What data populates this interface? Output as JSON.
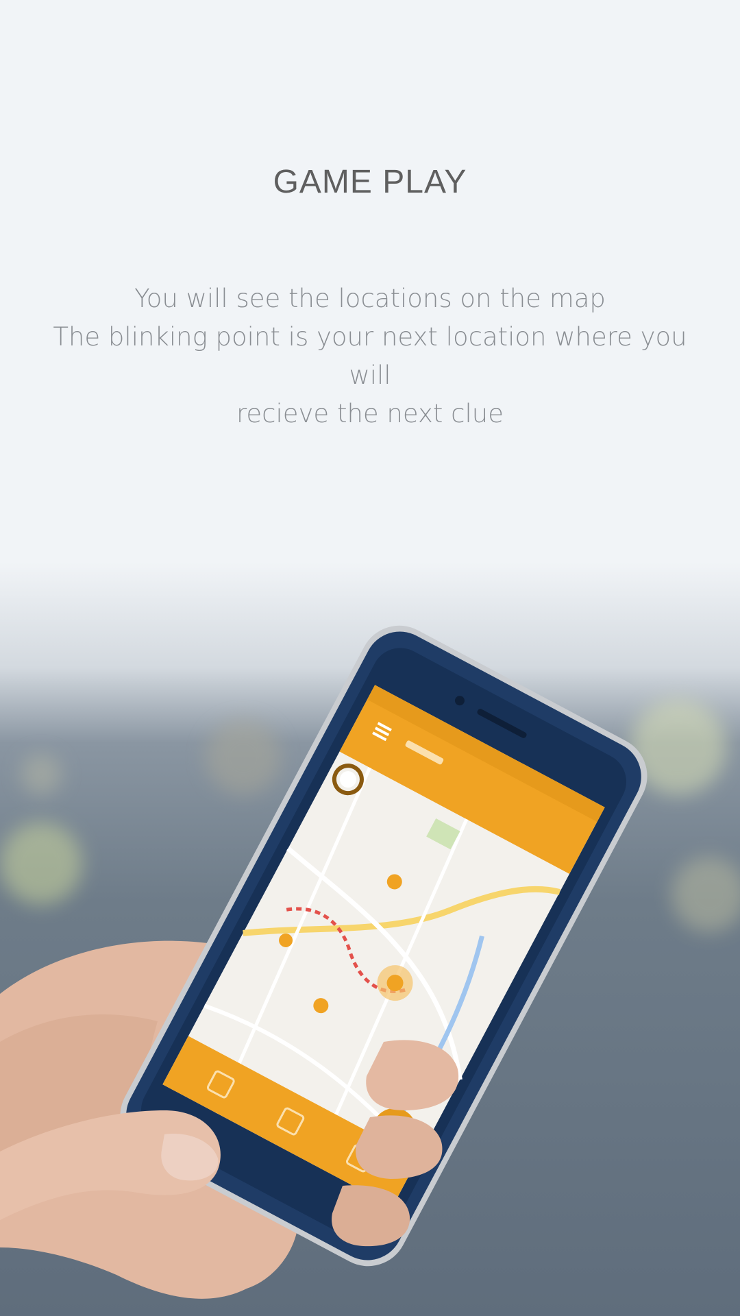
{
  "screen": {
    "title": "GAME PLAY",
    "description_lines": [
      "You will see the locations on the map",
      "The blinking point is your next location where you will",
      "recieve the next clue"
    ]
  },
  "colors": {
    "background": "#f1f4f7",
    "title": "#5f5f5f",
    "body_text": "#8a8e93",
    "accent_orange": "#f0a323",
    "phone_frame": "#1f3c66"
  }
}
